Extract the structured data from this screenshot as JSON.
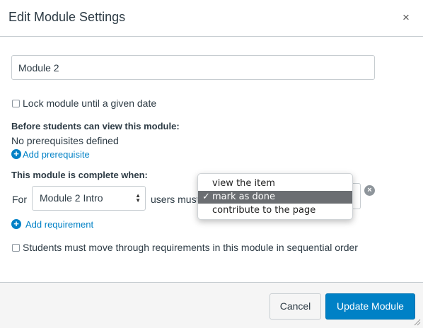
{
  "dialog": {
    "title": "Edit Module Settings",
    "close_symbol": "×"
  },
  "module_name": {
    "value": "Module 2"
  },
  "lock": {
    "label": "Lock module until a given date",
    "checked": false
  },
  "prerequisites": {
    "heading": "Before students can view this module:",
    "empty_text": "No prerequisites defined",
    "add_label": "Add prerequisite",
    "add_icon": "plus-circle-icon"
  },
  "requirements": {
    "heading": "This module is complete when:",
    "for_label": "For",
    "item_select_value": "Module 2 Intro",
    "users_must_label": "users must",
    "action_options": [
      "view the item",
      "mark as done",
      "contribute to the page"
    ],
    "selected_action": "mark as done",
    "remove_icon": "remove-x-circle-icon",
    "add_label": "Add requirement",
    "add_icon": "plus-circle-icon"
  },
  "sequential": {
    "label": "Students must move through requirements in this module in sequential order",
    "checked": false
  },
  "footer": {
    "cancel_label": "Cancel",
    "update_label": "Update Module"
  },
  "colors": {
    "accent": "#0081c6",
    "text": "#2d3b45",
    "footer_bg": "#f5f5f5"
  }
}
